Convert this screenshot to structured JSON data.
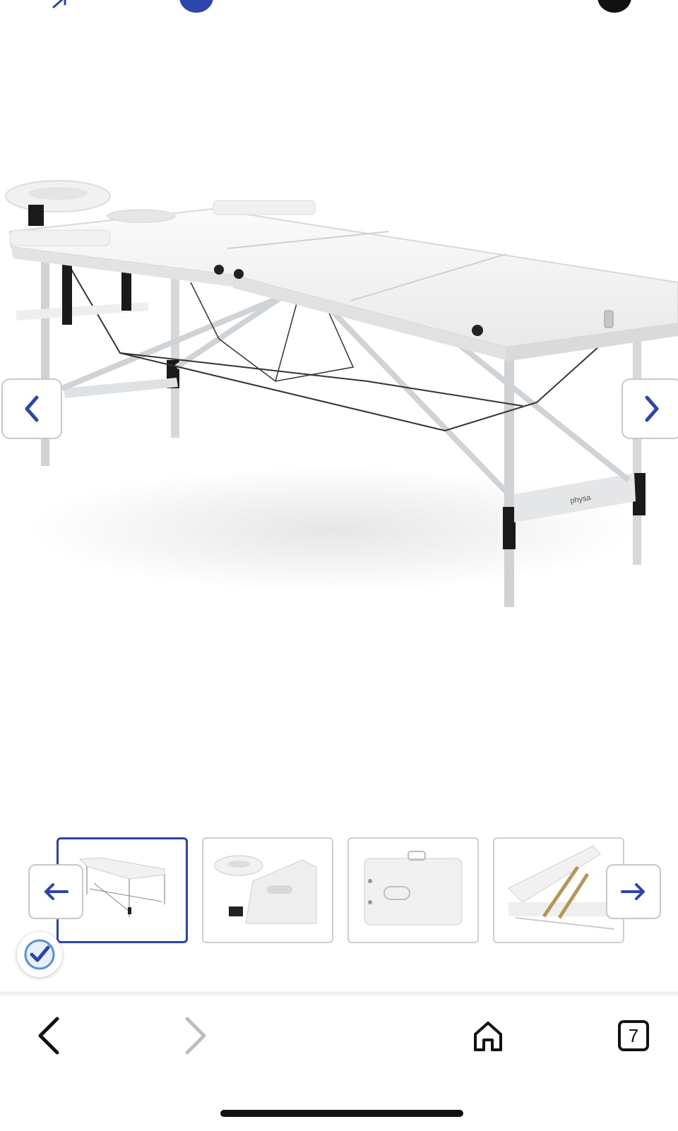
{
  "colors": {
    "accent": "#2c45a8",
    "border": "#c8c8c8",
    "table_white": "#f4f4f4",
    "frame_silver": "#cfd3d6",
    "icon_dark": "#111111",
    "icon_disabled": "#bdbdbd"
  },
  "gallery": {
    "main_image": {
      "brand_label": "physa"
    },
    "prev_icon": "chevron-left-icon",
    "next_icon": "chevron-right-icon",
    "thumbnails": [
      {
        "name": "full-table",
        "active": true
      },
      {
        "name": "headrest-detail",
        "active": false
      },
      {
        "name": "folded-case",
        "active": false
      },
      {
        "name": "backrest-support",
        "active": false
      }
    ],
    "thumb_prev_icon": "arrow-left-icon",
    "thumb_next_icon": "arrow-right-icon"
  },
  "badge": {
    "icon": "verified-checkmark-icon"
  },
  "browser": {
    "back_icon": "chevron-left-icon",
    "forward_icon": "chevron-right-icon",
    "forward_enabled": false,
    "home_icon": "home-icon",
    "tabs_count": "7"
  }
}
